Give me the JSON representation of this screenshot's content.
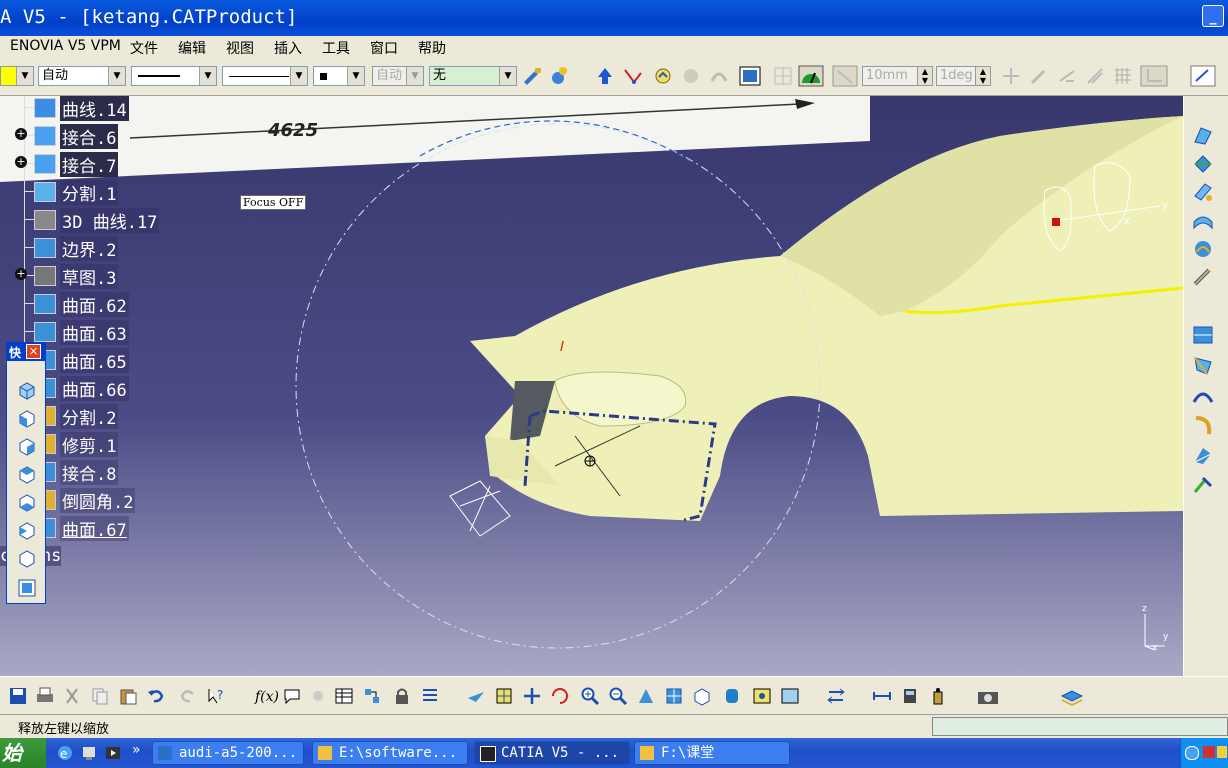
{
  "window": {
    "title": "A V5 - [ketang.CATProduct]",
    "minimize_label": "_"
  },
  "menu": [
    "ENOVIA V5 VPM",
    "文件",
    "编辑",
    "视图",
    "插入",
    "工具",
    "窗口",
    "帮助"
  ],
  "toolbar": {
    "color_combo": "自动",
    "layer_combo": "无",
    "auto_combo": "自动",
    "linear_step": "10mm",
    "angular_step": "1deg"
  },
  "tree": [
    {
      "label": "曲线.14",
      "selected": true,
      "expander": ""
    },
    {
      "label": "接合.6",
      "selected": true,
      "expander": "+"
    },
    {
      "label": "接合.7",
      "selected": true,
      "expander": "+"
    },
    {
      "label": "分割.1",
      "selected": false,
      "expander": ""
    },
    {
      "label": "3D 曲线.17",
      "selected": false,
      "expander": ""
    },
    {
      "label": "边界.2",
      "selected": false,
      "expander": ""
    },
    {
      "label": "草图.3",
      "selected": false,
      "expander": "+"
    },
    {
      "label": "曲面.62",
      "selected": false,
      "expander": ""
    },
    {
      "label": "曲面.63",
      "selected": false,
      "expander": ""
    },
    {
      "label": "曲面.65",
      "selected": false,
      "expander": ""
    },
    {
      "label": "曲面.66",
      "selected": false,
      "expander": ""
    },
    {
      "label": "分割.2",
      "selected": false,
      "expander": ""
    },
    {
      "label": "修剪.1",
      "selected": false,
      "expander": ""
    },
    {
      "label": "接合.8",
      "selected": false,
      "expander": ""
    },
    {
      "label": "倒圆角.2",
      "selected": false,
      "expander": ""
    },
    {
      "label": "曲面.67",
      "selected": false,
      "expander": ""
    }
  ],
  "tree_footer": "ctions",
  "viewport": {
    "dimension_value": "4625",
    "focus_label": "Focus OFF",
    "compass_y": "y",
    "compass_x": "x",
    "axis_z": "z",
    "axis_y": "y",
    "axis_x": "x"
  },
  "palette": {
    "title": "快",
    "close": "×"
  },
  "status": {
    "message": "释放左键以缩放"
  },
  "taskbar": {
    "start": "始",
    "more": "»",
    "tasks": [
      {
        "label": "audi-a5-200...",
        "active": false
      },
      {
        "label": "E:\\software...",
        "active": false
      },
      {
        "label": "CATIA V5 - ...",
        "active": true
      },
      {
        "label": "F:\\课堂",
        "active": false
      }
    ]
  },
  "colors": {
    "title_blue": "#0040c8",
    "car_body": "#eef0b8",
    "highlight_yellow": "#f5f000",
    "taskbar_blue": "#245edb"
  }
}
